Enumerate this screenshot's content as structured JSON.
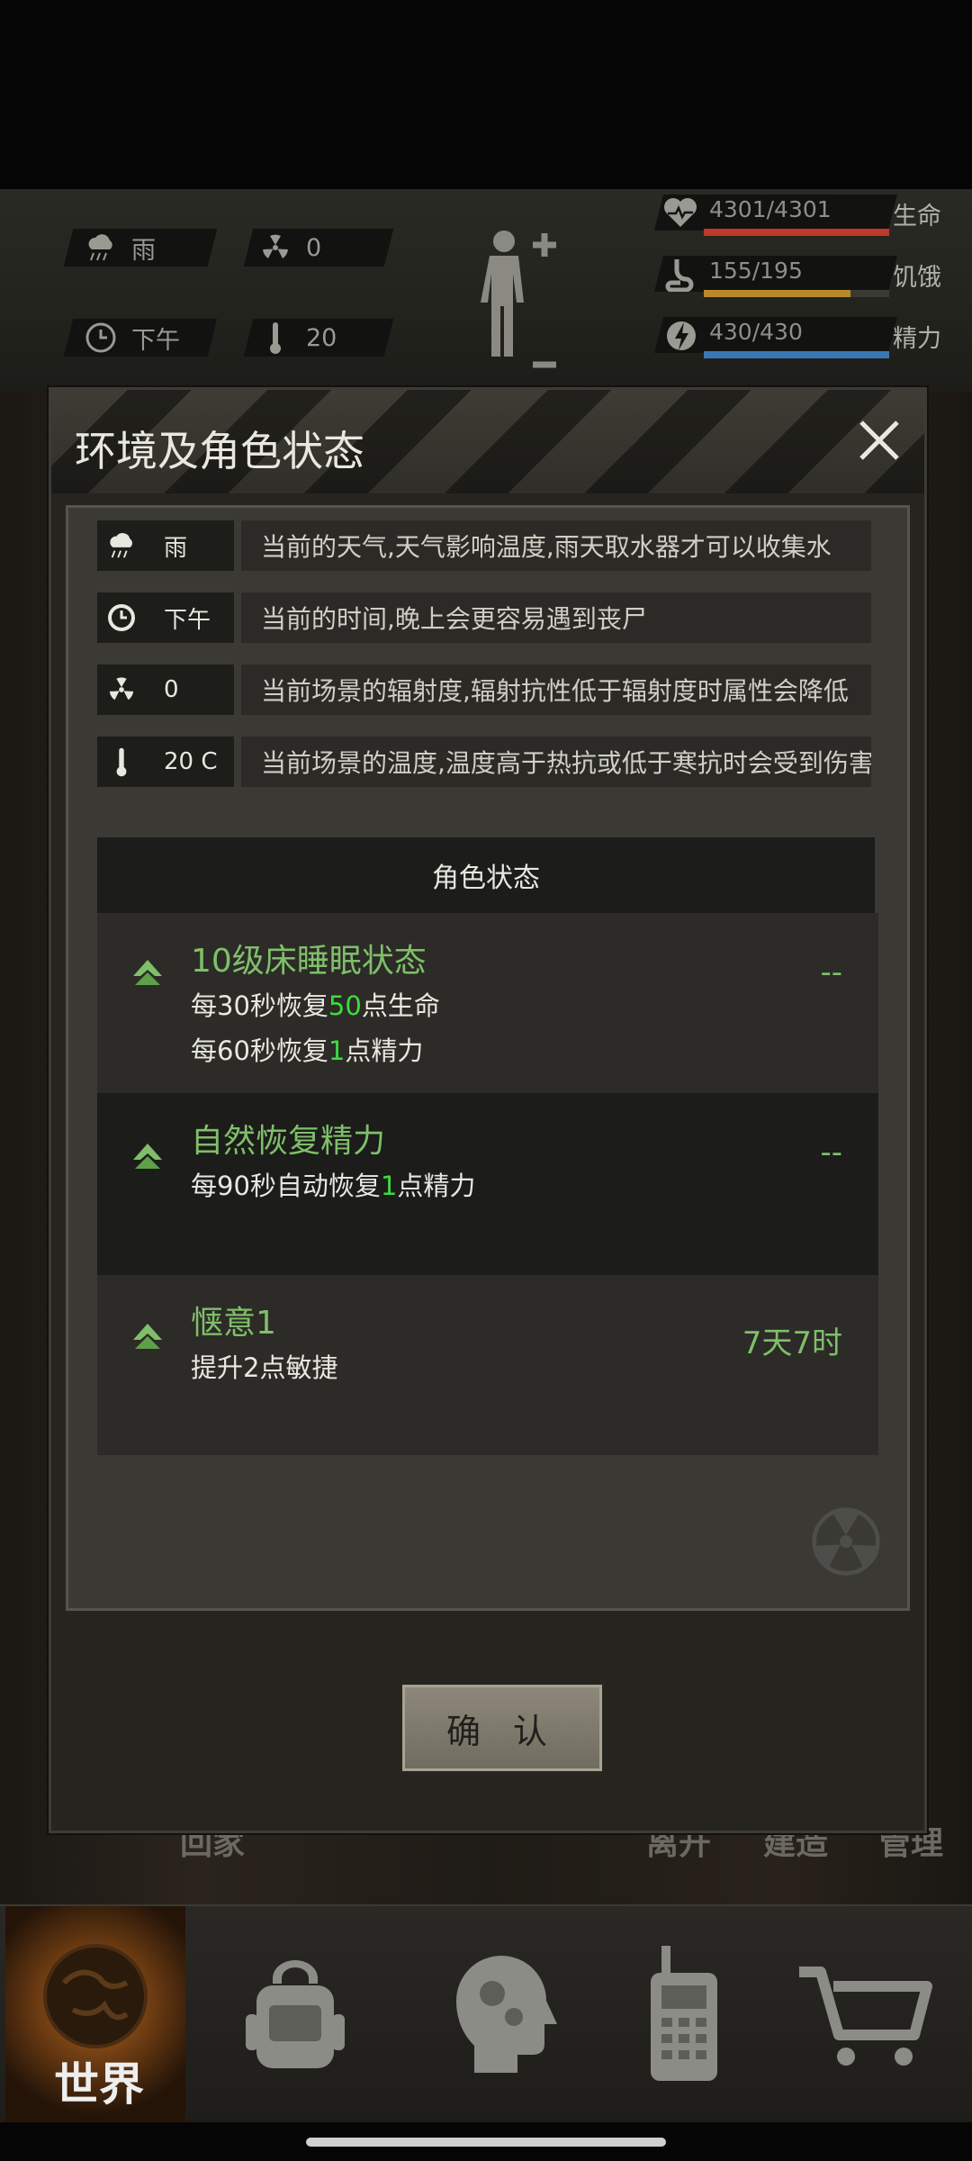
{
  "hud": {
    "weather": "雨",
    "radiation": "0",
    "time_of_day": "下午",
    "temperature": "20",
    "stats": [
      {
        "value": "4301/4301",
        "label": "生命",
        "fill": 1.0,
        "color": "#c0392b"
      },
      {
        "value": "155/195",
        "label": "饥饿",
        "fill": 0.79,
        "color": "#b8892c"
      },
      {
        "value": "430/430",
        "label": "精力",
        "fill": 1.0,
        "color": "#3a78b5"
      }
    ]
  },
  "background": {
    "buttons": [
      "回家",
      "离开",
      "建造",
      "管理"
    ]
  },
  "dialog": {
    "title": "环境及角色状态",
    "env_rows": [
      {
        "key": "雨",
        "icon": "rain-cloud-icon",
        "desc": "当前的天气,天气影响温度,雨天取水器才可以收集水"
      },
      {
        "key": "下午",
        "icon": "clock-icon",
        "desc": "当前的时间,晚上会更容易遇到丧尸"
      },
      {
        "key": "0",
        "icon": "radiation-icon",
        "desc": "当前场景的辐射度,辐射抗性低于辐射度时属性会降低"
      },
      {
        "key": "20 C",
        "icon": "thermometer-icon",
        "desc": "当前场景的温度,温度高于热抗或低于寒抗时会受到伤害"
      }
    ],
    "status_header": "角色状态",
    "status_items": [
      {
        "name": "10级床睡眠状态",
        "duration": "--",
        "line1_a": "每30秒恢复",
        "line1_hl": "50",
        "line1_b": "点生命",
        "line2_a": "每60秒恢复",
        "line2_hl": "1",
        "line2_b": "点精力"
      },
      {
        "name": "自然恢复精力",
        "duration": "--",
        "line1_a": "每90秒自动恢复",
        "line1_hl": "1",
        "line1_b": "点精力"
      },
      {
        "name": "惬意1",
        "duration": "7天7时",
        "line1_a": "提升2点敏捷"
      }
    ],
    "confirm_label": "确 认"
  },
  "bottom_nav": {
    "world_label": "世界",
    "items": [
      "backpack-icon",
      "head-gears-icon",
      "radio-icon",
      "cart-icon"
    ]
  }
}
